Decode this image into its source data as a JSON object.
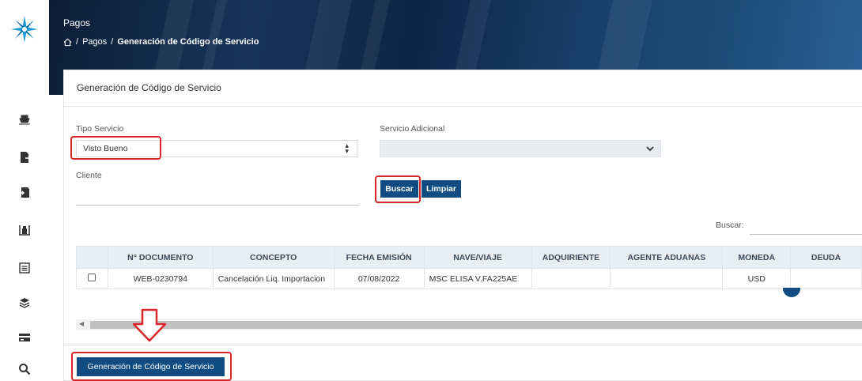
{
  "header": {
    "title": "Pagos",
    "breadcrumb": {
      "home_icon": "home-icon",
      "sep": "/",
      "section": "Pagos",
      "current": "Generación de Código de Servicio"
    }
  },
  "sidebar": {
    "logo_icon": "compass-star-logo",
    "items": [
      {
        "icon": "ship-icon"
      },
      {
        "icon": "export-document-icon"
      },
      {
        "icon": "import-document-icon"
      },
      {
        "icon": "warehouse-icon"
      },
      {
        "icon": "list-icon"
      },
      {
        "icon": "layers-icon"
      },
      {
        "icon": "credit-card-icon"
      },
      {
        "icon": "search-icon"
      }
    ]
  },
  "card": {
    "title": "Generación de Código de Servicio",
    "form": {
      "tipo_servicio_label": "Tipo Servicio",
      "tipo_servicio_value": "Visto Bueno",
      "servicio_adicional_label": "Servicio Adicional",
      "servicio_adicional_value": "",
      "cliente_label": "Cliente",
      "cliente_value": ""
    },
    "buttons": {
      "buscar": "Buscar",
      "limpiar": "Limpiar",
      "generar": "Generación de Código de Servicio"
    },
    "search": {
      "label": "Buscar:",
      "value": ""
    },
    "table": {
      "headers": [
        "N° DOCUMENTO",
        "CONCEPTO",
        "FECHA EMISIÓN",
        "NAVE/VIAJE",
        "ADQUIRIENTE",
        "AGENTE ADUANAS",
        "MONEDA",
        "DEUDA"
      ],
      "rows": [
        {
          "documento": "WEB-0230794",
          "concepto": "Cancelación Liq. Importacion",
          "fecha": "07/08/2022",
          "nave": "MSC ELISA V.FA225AE",
          "adquiriente": "",
          "agente": "",
          "moneda": "USD",
          "deuda": ""
        }
      ]
    }
  },
  "colors": {
    "primary": "#0f4c81",
    "highlight": "#d9262a",
    "banner": "#173558"
  }
}
